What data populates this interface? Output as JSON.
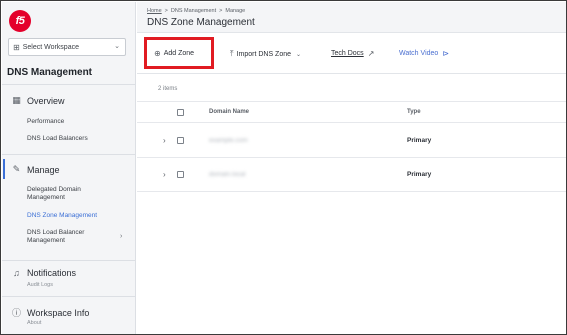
{
  "logo": {
    "text": "f5"
  },
  "workspace": {
    "label": "Select Workspace",
    "icon": "grid-icon"
  },
  "sidebar": {
    "title": "DNS Management",
    "overview": {
      "label": "Overview",
      "icon": "overview-grid-icon"
    },
    "overview_items": [
      {
        "label": "Performance"
      },
      {
        "label": "DNS Load Balancers"
      }
    ],
    "manage": {
      "label": "Manage",
      "icon": "pencil-icon"
    },
    "manage_items": [
      {
        "label": "Delegated Domain Management"
      },
      {
        "label": "DNS Zone Management"
      },
      {
        "label": "DNS Load Balancer Management"
      }
    ],
    "notifications": {
      "label": "Notifications",
      "icon": "bell-icon",
      "sub": "Audit Logs"
    },
    "workspace_info": {
      "label": "Workspace Info",
      "icon": "info-icon",
      "sub": "About"
    }
  },
  "breadcrumb": {
    "home": "Home",
    "level1": "DNS Management",
    "level2": "Manage",
    "separator": ">"
  },
  "page": {
    "title": "DNS Zone Management"
  },
  "toolbar": {
    "add_zone": "Add Zone",
    "import_zone": "Import DNS Zone",
    "tech_docs": "Tech Docs",
    "watch_video": "Watch Video"
  },
  "table": {
    "count": "2 items",
    "columns": [
      "Domain Name",
      "Type"
    ],
    "rows": [
      {
        "domain": "example.com",
        "type": "Primary"
      },
      {
        "domain": "domain.local",
        "type": "Primary"
      }
    ]
  },
  "colors": {
    "accent": "#3b6fd6",
    "highlight": "#e11b22",
    "logo": "#e4002b"
  }
}
